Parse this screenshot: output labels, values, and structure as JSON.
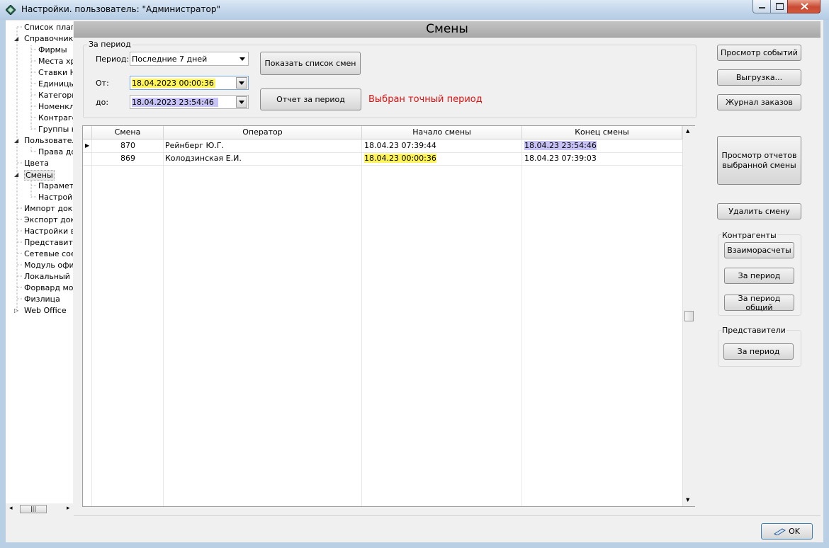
{
  "window": {
    "title": "Настройки. пользователь: \"Администратор\"",
    "controls": {
      "minimize": "–",
      "maximize": "□",
      "close": "✕"
    }
  },
  "tree": {
    "items": [
      {
        "label": "Список плагинов",
        "level": 0,
        "expander": ""
      },
      {
        "label": "Справочники",
        "level": 0,
        "expander": "◢"
      },
      {
        "label": "Фирмы",
        "level": 1,
        "expander": ""
      },
      {
        "label": "Места хранения",
        "level": 1,
        "expander": ""
      },
      {
        "label": "Ставки НДС",
        "level": 1,
        "expander": ""
      },
      {
        "label": "Единицы измерения",
        "level": 1,
        "expander": ""
      },
      {
        "label": "Категории",
        "level": 1,
        "expander": ""
      },
      {
        "label": "Номенклатура",
        "level": 1,
        "expander": ""
      },
      {
        "label": "Контрагенты",
        "level": 1,
        "expander": ""
      },
      {
        "label": "Группы номенклатуры",
        "level": 1,
        "expander": ""
      },
      {
        "label": "Пользователи",
        "level": 0,
        "expander": "◢"
      },
      {
        "label": "Права доступа",
        "level": 1,
        "expander": ""
      },
      {
        "label": "Цвета",
        "level": 0,
        "expander": ""
      },
      {
        "label": "Смены",
        "level": 0,
        "expander": "◢",
        "selected": true
      },
      {
        "label": "Параметры",
        "level": 1,
        "expander": ""
      },
      {
        "label": "Настройки",
        "level": 1,
        "expander": ""
      },
      {
        "label": "Импорт документов",
        "level": 0,
        "expander": ""
      },
      {
        "label": "Экспорт документов",
        "level": 0,
        "expander": ""
      },
      {
        "label": "Настройки внешнего вида",
        "level": 0,
        "expander": ""
      },
      {
        "label": "Представители",
        "level": 0,
        "expander": ""
      },
      {
        "label": "Сетевые соединения",
        "level": 0,
        "expander": ""
      },
      {
        "label": "Модуль офиса",
        "level": 0,
        "expander": ""
      },
      {
        "label": "Локальный сервер",
        "level": 0,
        "expander": ""
      },
      {
        "label": "Форвард мобайл",
        "level": 0,
        "expander": ""
      },
      {
        "label": "Физлица",
        "level": 0,
        "expander": ""
      },
      {
        "label": "Web Office",
        "level": 0,
        "expander": "▷"
      }
    ],
    "scroll": {
      "left": "◂",
      "thumb": "|||",
      "right": "▸"
    }
  },
  "header": {
    "title": "Смены"
  },
  "period": {
    "legend": "За период",
    "period_label": "Период:",
    "period_value": "Последние 7 дней",
    "from_label": "От:",
    "from_value": "18.04.2023 00:00:36",
    "to_label": "до:",
    "to_value": "18.04.2023 23:54:46",
    "show_button": "Показать список смен",
    "report_button": "Отчет за период",
    "status": "Выбран точный период"
  },
  "grid": {
    "columns": [
      "Смена",
      "Оператор",
      "Начало смены",
      "Конец смены"
    ],
    "rows": [
      {
        "shift": "870",
        "operator": "Рейнберг Ю.Г.",
        "start": "18.04.23 07:39:44",
        "end": "18.04.23 23:54:46",
        "current": true
      },
      {
        "shift": "869",
        "operator": "Колодзинская Е.И.",
        "start": "18.04.23 00:00:36",
        "end": "18.04.23 07:39:03",
        "current": false
      }
    ],
    "row_indicator": "▶",
    "scroll_up": "▲",
    "scroll_down": "▼"
  },
  "right_panel": {
    "events_button": "Просмотр событий",
    "export_button": "Выгрузка...",
    "orders_button": "Журнал заказов",
    "shift_reports_button": "Просмотр отчетов выбранной смены",
    "delete_shift_button": "Удалить смену",
    "contractors": {
      "title": "Контрагенты",
      "settlements_button": "Взаиморасчеты",
      "period_button": "За период",
      "period_total_button": "За период общий"
    },
    "representatives": {
      "title": "Представители",
      "period_button": "За период"
    }
  },
  "footer": {
    "ok_button": "OK"
  },
  "colors": {
    "status_red": "#e01010",
    "highlight_yellow": "#fff45a",
    "highlight_blue": "#c7c3f6"
  }
}
